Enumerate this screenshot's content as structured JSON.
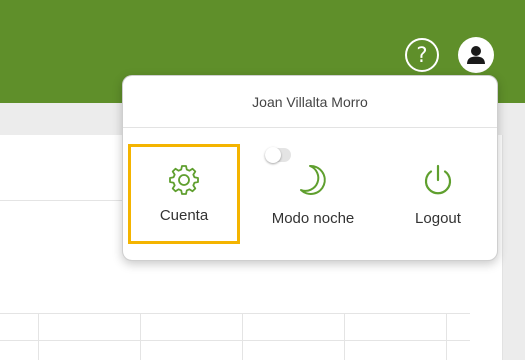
{
  "header": {
    "help_label": "?",
    "accent_color": "#5f8f2a"
  },
  "user_menu": {
    "user_name": "Joan Villalta Morro",
    "items": [
      {
        "label": "Cuenta",
        "icon": "gear-icon",
        "highlighted": true
      },
      {
        "label": "Modo noche",
        "icon": "moon-icon",
        "toggle_on": false
      },
      {
        "label": "Logout",
        "icon": "power-icon"
      }
    ],
    "highlight_color": "#f4b400",
    "icon_color": "#5f9f2e"
  }
}
